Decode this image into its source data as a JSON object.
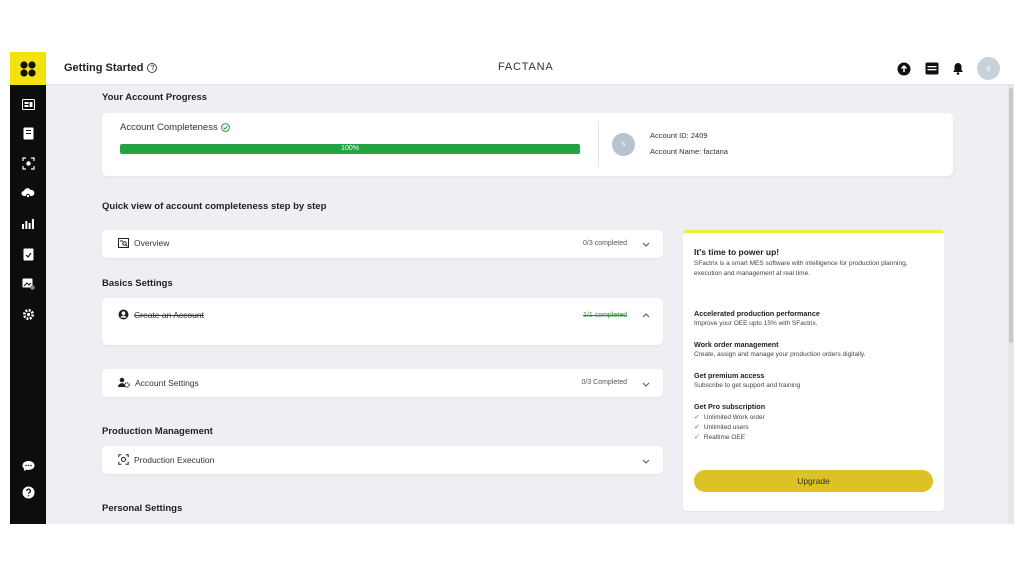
{
  "header": {
    "title": "Getting Started",
    "help_glyph": "?",
    "brand": "FACTANA",
    "user_initial": "s"
  },
  "progress": {
    "section_title": "Your Account Progress",
    "label": "Account Completeness",
    "percent_label": "100%",
    "percent_value": 100,
    "avatar_initial": "s",
    "account_id": "Account ID: 2409",
    "account_name": "Account Name: factana"
  },
  "steps": {
    "section_title": "Quick view of account completeness step by step",
    "overview": {
      "label": "Overview",
      "status": "0/3 completed"
    },
    "basics_title": "Basics Settings",
    "create_account": {
      "label": "Create an Account",
      "status": "1/1 completed"
    },
    "account_settings": {
      "label": "Account Settings",
      "status": "0/3 Completed"
    },
    "production_title": "Production Management",
    "production_execution": {
      "label": "Production Execution"
    },
    "personal_title": "Personal Settings"
  },
  "promo": {
    "title": "It's time to power up!",
    "description": "SFactrix is a smart MES software with intelligence for production planning, execution and management at real time.",
    "features": [
      {
        "title": "Accelerated production performance",
        "text": "Improve your OEE upto 15% with SFactrix."
      },
      {
        "title": "Work order management",
        "text": "Create, assign and manage your production orders digitally."
      },
      {
        "title": "Get premium access",
        "text": "Subscribe to get support and training"
      }
    ],
    "pro_title": "Get Pro subscription",
    "pro_items": [
      "Unlimited Work order",
      "Unlimited users",
      "Realtime OEE"
    ],
    "upgrade_label": "Upgrade"
  },
  "colors": {
    "accent_yellow": "#f4e20f",
    "progress_green": "#25a244",
    "sidebar_bg": "#0d0d0d",
    "upgrade_button": "#dcc227"
  },
  "icons": {
    "sidebar": [
      "dashboard-icon",
      "book-icon",
      "scan-icon",
      "cloud-gear-icon",
      "chart-icon",
      "document-icon",
      "image-edit-icon",
      "gear-icon",
      "chat-icon",
      "help-icon"
    ],
    "topbar": [
      "upload-icon",
      "calendar-icon",
      "bell-icon"
    ]
  }
}
